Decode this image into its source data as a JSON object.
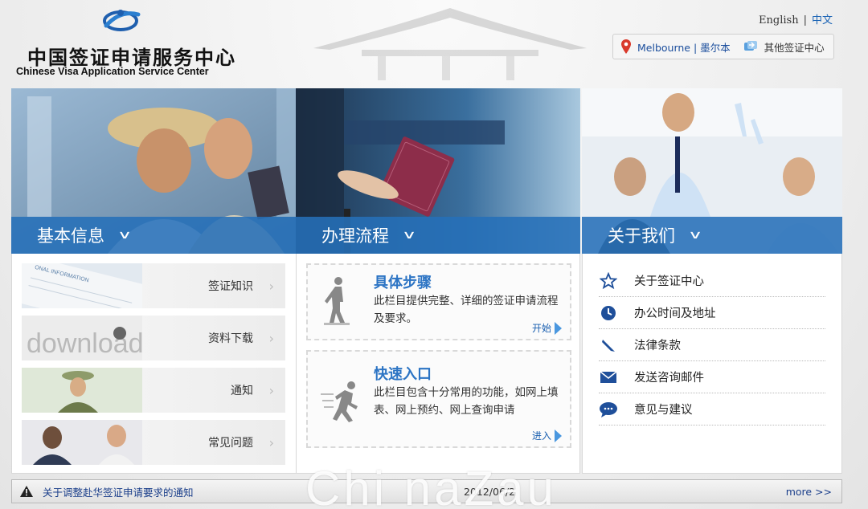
{
  "header": {
    "logo_cn": "中国签证申请服务中心",
    "logo_en": "Chinese Visa Application Service Center",
    "lang_en": "English",
    "lang_sep": "|",
    "lang_zh": "中文",
    "location_city": "Melbourne | 墨尔本",
    "location_other": "其他签证中心"
  },
  "columns": [
    {
      "title": "基本信息",
      "chevron": "chevron-down-icon"
    },
    {
      "title": "办理流程",
      "chevron": "chevron-down-icon"
    },
    {
      "title": "关于我们",
      "chevron": "chevron-down-icon"
    }
  ],
  "basic_info": {
    "items": [
      {
        "label": "签证知识",
        "arrow": "›"
      },
      {
        "label": "资料下载",
        "arrow": "›"
      },
      {
        "label": "通知",
        "arrow": "›"
      },
      {
        "label": "常见问题",
        "arrow": "›"
      }
    ],
    "thumb_texts": {
      "info": "ONAL INFORMATION",
      "download": "download"
    }
  },
  "process": {
    "steps": {
      "title": "具体步骤",
      "desc": "此栏目提供完整、详细的签证申请流程及要求。",
      "link": "开始"
    },
    "quick": {
      "title": "快速入口",
      "desc": "此栏目包含十分常用的功能，如网上填表、网上预约、网上查询申请",
      "link": "进入"
    }
  },
  "about": {
    "items": [
      {
        "label": "关于签证中心",
        "icon": "star-icon"
      },
      {
        "label": "办公时间及地址",
        "icon": "clock-icon"
      },
      {
        "label": "法律条款",
        "icon": "pen-icon"
      },
      {
        "label": "发送咨询邮件",
        "icon": "envelope-icon"
      },
      {
        "label": "意见与建议",
        "icon": "speech-bubble-icon"
      }
    ]
  },
  "notice": {
    "text": "关于调整赴华签证申请要求的通知",
    "date": "2012/06/2",
    "more": "more >>",
    "icon": "warning-icon"
  },
  "watermark": "Chi naZau",
  "colors": {
    "band": "#256fb8",
    "link": "#1a63b5",
    "title_blue": "#2c74c4"
  }
}
